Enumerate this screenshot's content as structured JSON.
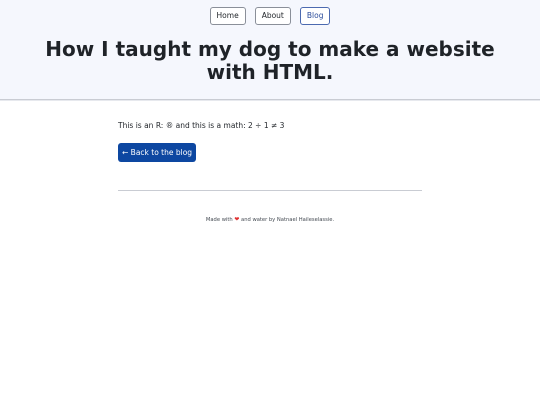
{
  "header": {
    "nav": [
      {
        "label": "Home",
        "active": false
      },
      {
        "label": "About",
        "active": false
      },
      {
        "label": "Blog",
        "active": true
      }
    ],
    "title": "How I taught my dog to make a website with HTML."
  },
  "main": {
    "content_text": "This is an R: ® and this is a math: 2 ÷ 1 ≠ 3",
    "back_button_label": "← Back to the blog"
  },
  "footer": {
    "prefix": "Made with",
    "heart_icon": "heart-icon",
    "heart_glyph": "❤",
    "suffix": "and water by Natnael Haileselassie."
  },
  "colors": {
    "header_bg": "#f5f7fd",
    "button_bg": "#0d47a1",
    "active_nav": "#2b4c9b",
    "heart": "#e03131"
  }
}
